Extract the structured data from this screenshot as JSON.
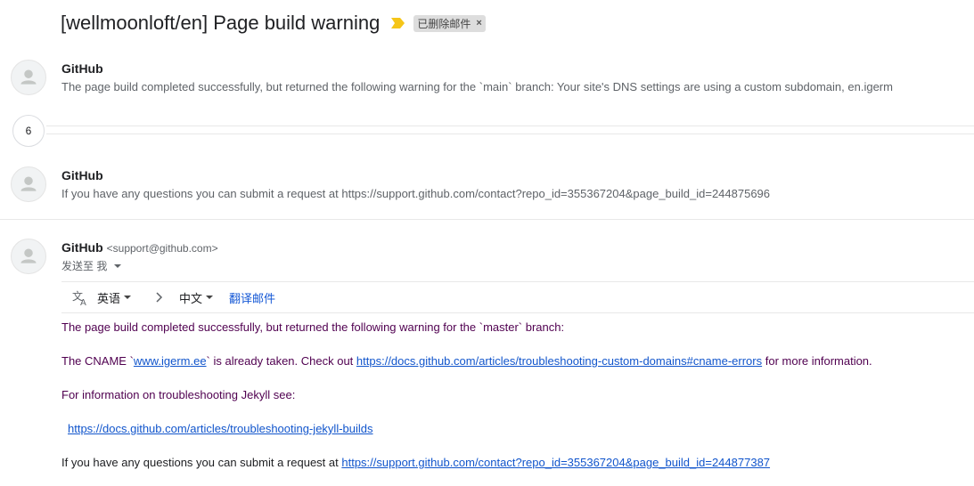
{
  "subject": {
    "title": "[wellmoonloft/en] Page build warning",
    "importance_icon": "importance-marker-icon",
    "label_chip": {
      "text": "已删除邮件",
      "close": "×"
    }
  },
  "messages": [
    {
      "sender": "GitHub",
      "snippet": "The page build completed successfully, but returned the following warning for the `main` branch: Your site's DNS settings are using a custom subdomain, en.igerm"
    },
    {
      "sender": "GitHub",
      "snippet": "If you have any questions you can submit a request at https://support.github.com/contact?repo_id=355367204&page_build_id=244875696"
    }
  ],
  "collapsed_count": "6",
  "open_message": {
    "sender": "GitHub",
    "email": "<support@github.com>",
    "to_line": "发送至 我",
    "translate": {
      "source_lang": "英语",
      "target_lang": "中文",
      "action": "翻译邮件"
    },
    "body": {
      "line1": "The page build completed successfully, but returned the following warning for the `master` branch:",
      "line2_pre": "The CNAME `",
      "line2_link1": "www.igerm.ee",
      "line2_mid": "` is already taken. Check out ",
      "line2_link2": "https://docs.github.com/articles/troubleshooting-custom-domains#cname-errors",
      "line2_post": " for more information.",
      "line3": "For information on troubleshooting Jekyll see:",
      "line4_link": "https://docs.github.com/articles/troubleshooting-jekyll-builds",
      "line5_pre": "If you have any questions you can submit a request at ",
      "line5_link": "https://support.github.com/contact?repo_id=355367204&page_build_id=244877387"
    }
  },
  "colors": {
    "importance": "#f5c518",
    "body_quoted": "#500050",
    "link": "#1155cc"
  }
}
